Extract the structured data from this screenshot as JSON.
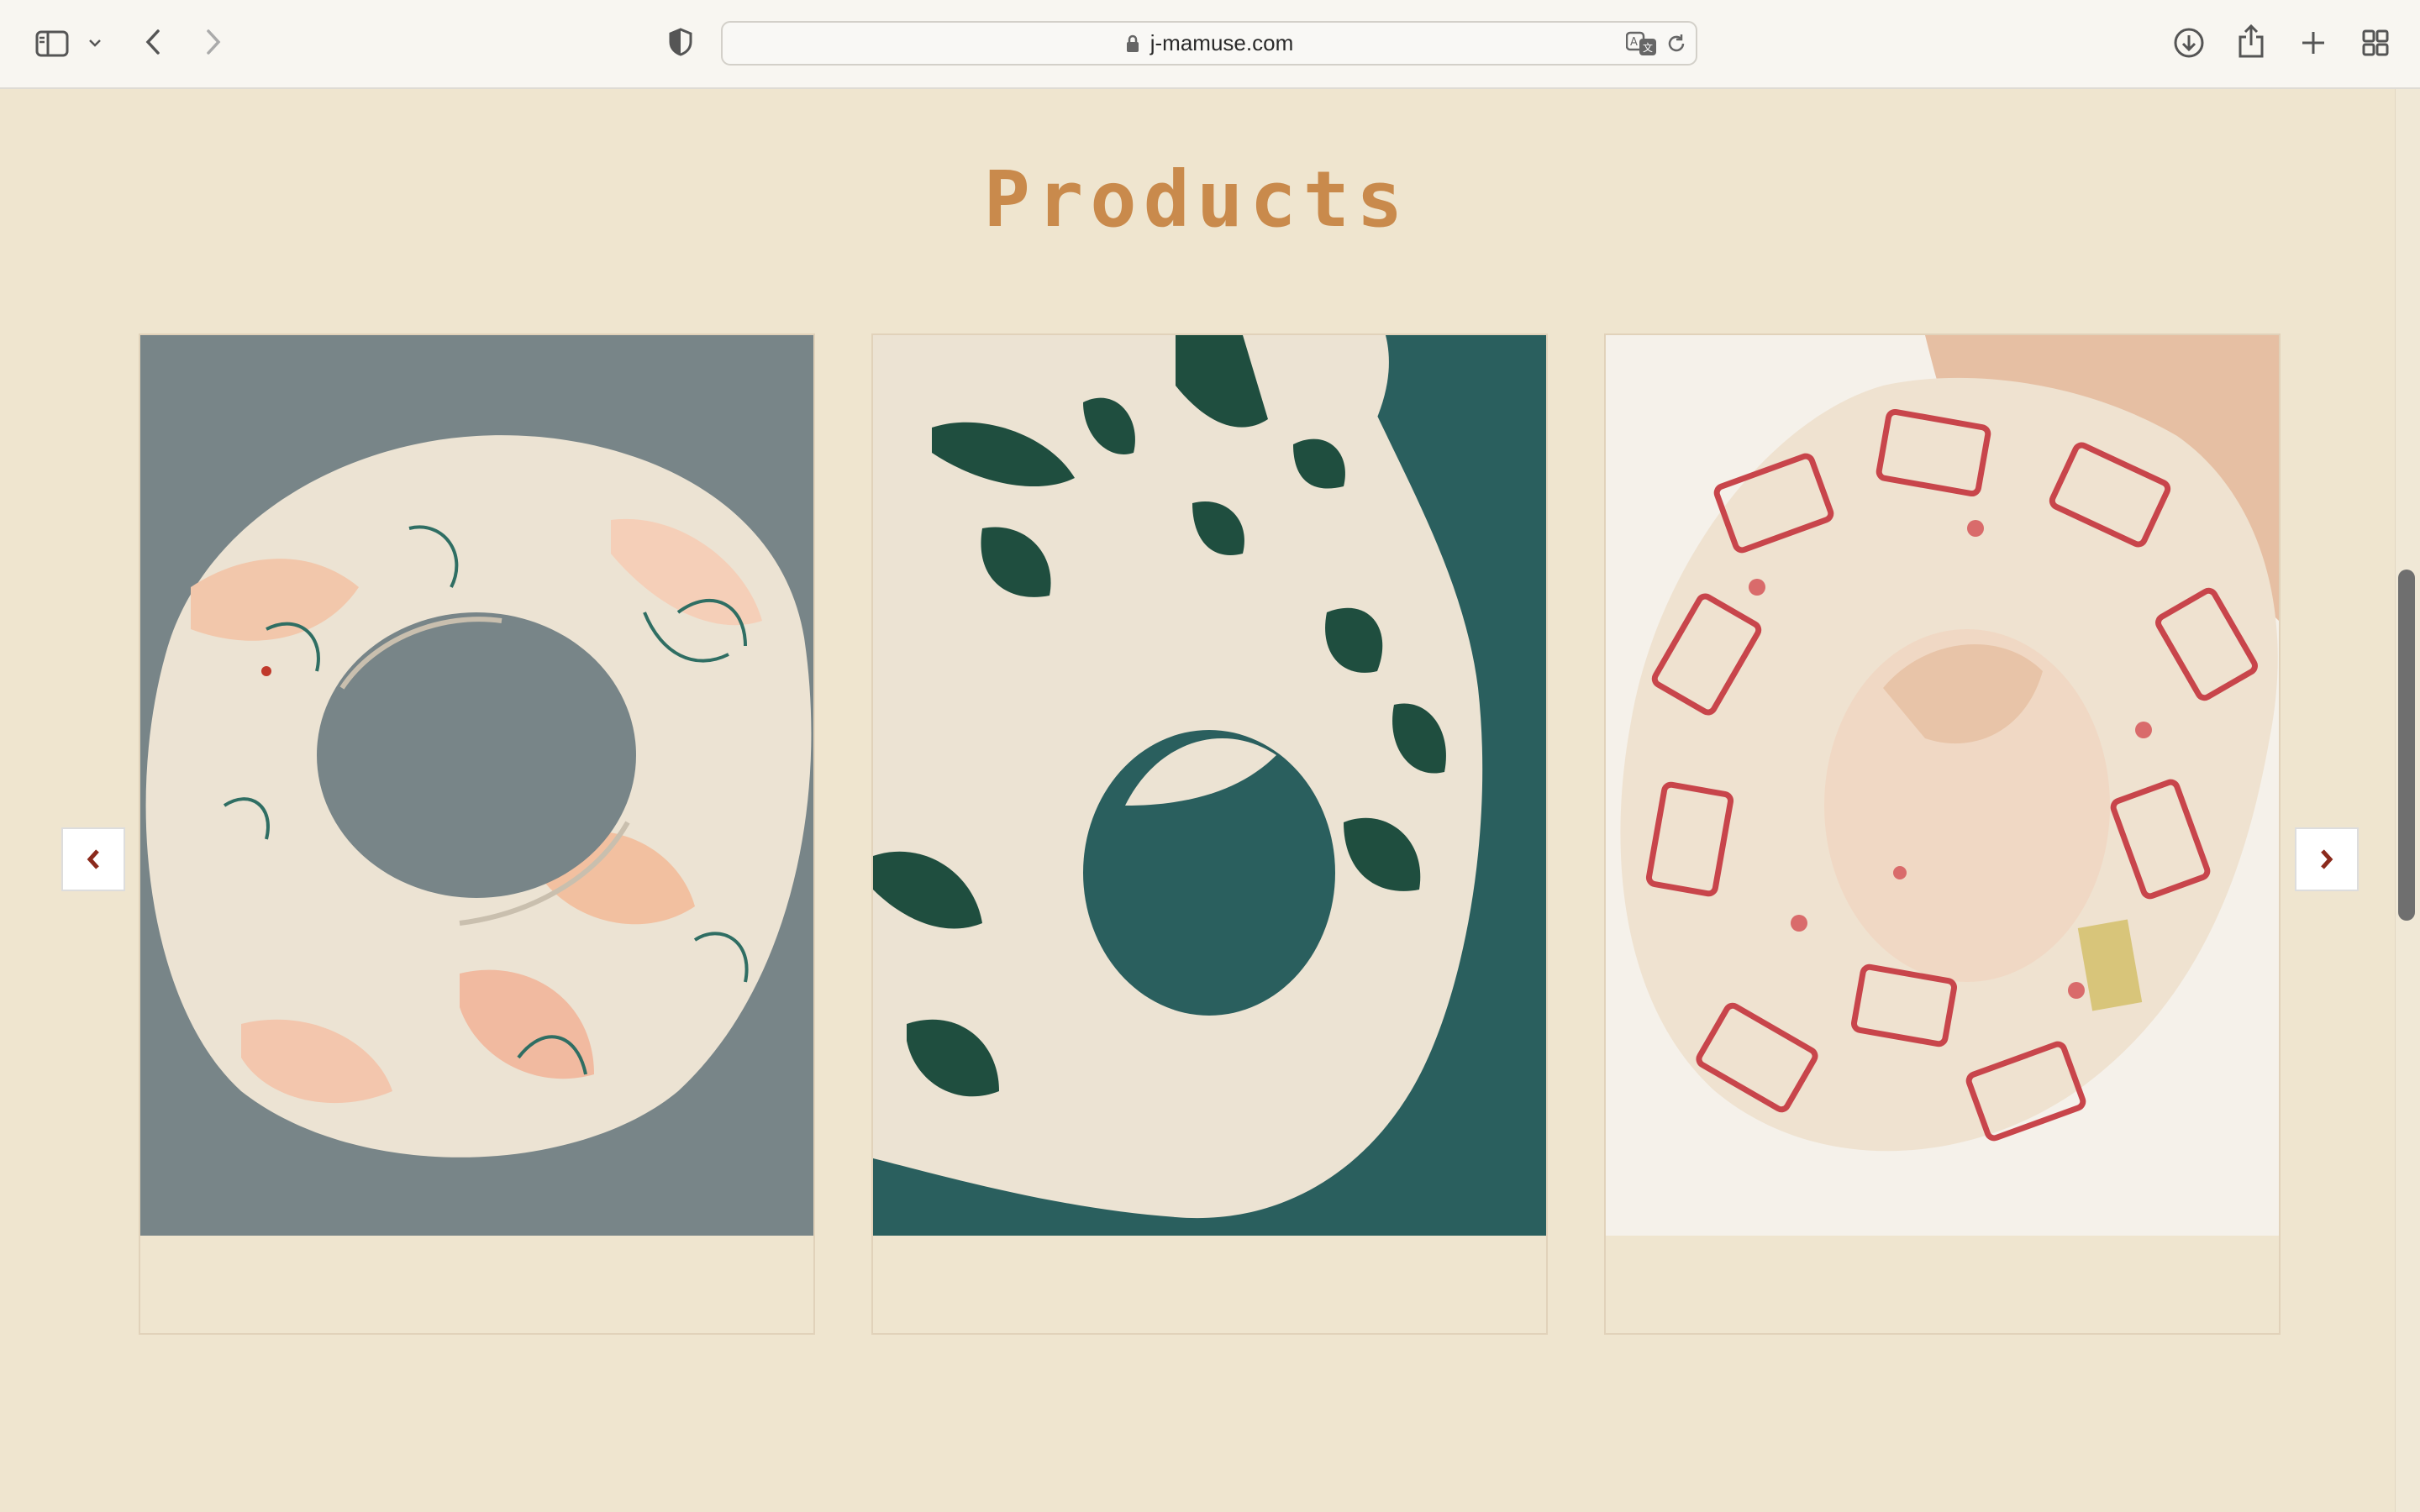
{
  "browser": {
    "url": "j-mamuse.com",
    "icons": [
      "sidebar-icon",
      "chevron-down-icon",
      "back-arrow-icon",
      "forward-arrow-icon",
      "shield-icon",
      "lock-icon",
      "translate-icon",
      "reload-icon",
      "download-icon",
      "share-icon",
      "plus-icon",
      "tab-overview-icon"
    ]
  },
  "section": {
    "title": "Products"
  },
  "carousel": {
    "prev_icon": "chevron-left-icon",
    "next_icon": "chevron-right-icon",
    "products": [
      {
        "image": "scrunchie-sketch-print",
        "background": "#788588"
      },
      {
        "image": "scrunchie-cactus-print",
        "background": "#2a5f5e"
      },
      {
        "image": "scrunchie-cassette-print",
        "background": "#f5f1ea"
      }
    ]
  },
  "colors": {
    "accent": "#c98a4c",
    "page_bg": "#efe5cf",
    "arrow": "#8b2a1c"
  }
}
